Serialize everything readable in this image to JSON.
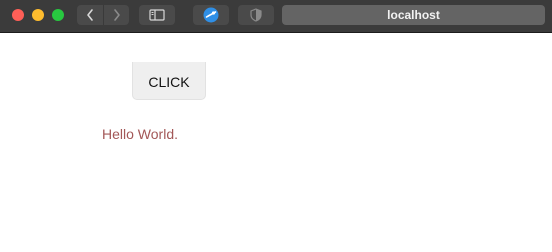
{
  "browser": {
    "address": "localhost",
    "icons": {
      "back": "chevron-left-icon",
      "forward": "chevron-right-icon",
      "sidebar": "sidebar-icon",
      "extension": "extension-icon",
      "privacy": "shield-icon"
    }
  },
  "content": {
    "button_label": "CLICK",
    "message": "Hello World."
  },
  "colors": {
    "message_text": "#a35757",
    "toolbar": "#3b3b3b",
    "button_bg": "#efefef"
  }
}
